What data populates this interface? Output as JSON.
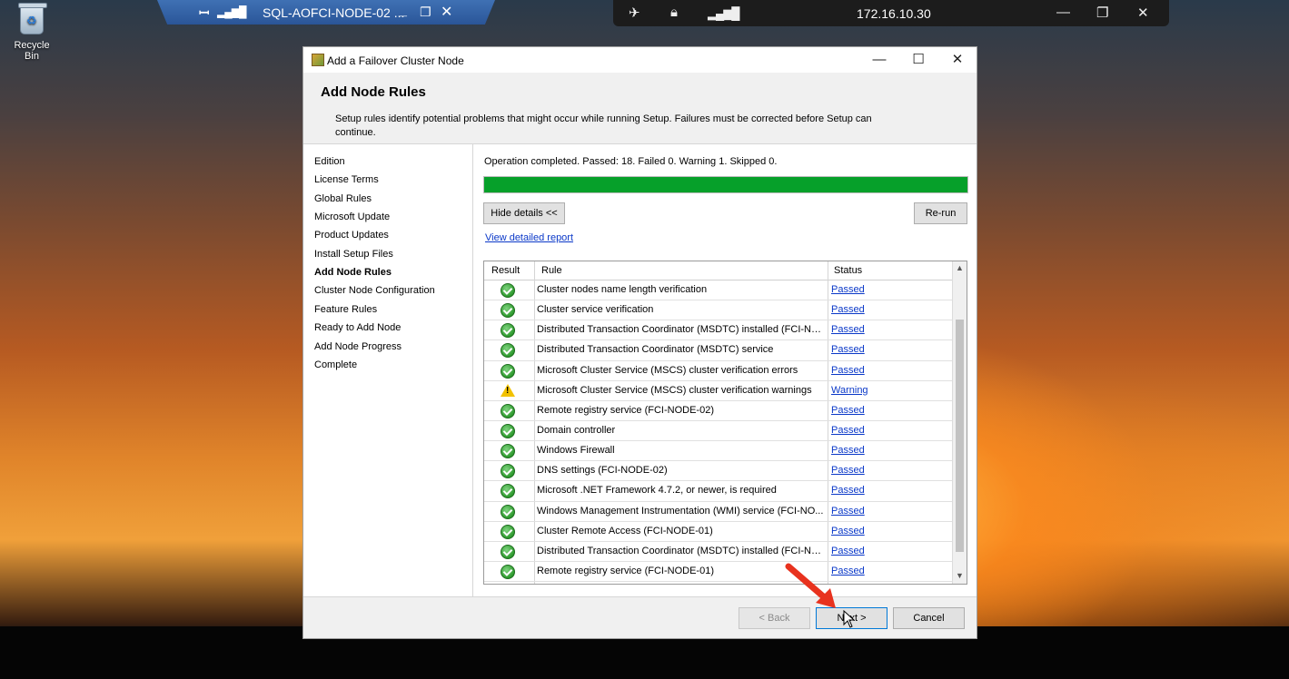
{
  "desktop": {
    "recycle_bin_label": "Recycle Bin"
  },
  "rdp_bar": {
    "title": "SQL-AOFCI-NODE-02 ..."
  },
  "remote_toolbar": {
    "ip_address": "172.16.10.30"
  },
  "dialog": {
    "window_title": "Add a Failover Cluster Node",
    "page_title": "Add Node Rules",
    "description": "Setup rules identify potential problems that might occur while running Setup. Failures must be corrected before Setup can continue.",
    "nav_items": [
      "Edition",
      "License Terms",
      "Global Rules",
      "Microsoft Update",
      "Product Updates",
      "Install Setup Files",
      "Add Node Rules",
      "Cluster Node Configuration",
      "Feature Rules",
      "Ready to Add Node",
      "Add Node Progress",
      "Complete"
    ],
    "active_nav": "Add Node Rules",
    "summary": "Operation completed. Passed: 18.   Failed 0.   Warning 1.   Skipped 0.",
    "progress_fraction": 1.0,
    "progress_color": "#06a02a",
    "hide_details_label": "Hide details <<",
    "rerun_label": "Re-run",
    "report_link": "View detailed report",
    "grid": {
      "columns": [
        "Result",
        "Rule",
        "Status"
      ],
      "rows": [
        {
          "result": "passed",
          "rule": "Cluster nodes name length verification",
          "status": "Passed"
        },
        {
          "result": "passed",
          "rule": "Cluster service verification",
          "status": "Passed"
        },
        {
          "result": "passed",
          "rule": "Distributed Transaction Coordinator (MSDTC) installed (FCI-NO...",
          "status": "Passed"
        },
        {
          "result": "passed",
          "rule": "Distributed Transaction Coordinator (MSDTC) service",
          "status": "Passed"
        },
        {
          "result": "passed",
          "rule": "Microsoft Cluster Service (MSCS) cluster verification errors",
          "status": "Passed"
        },
        {
          "result": "warning",
          "rule": "Microsoft Cluster Service (MSCS) cluster verification warnings",
          "status": "Warning"
        },
        {
          "result": "passed",
          "rule": "Remote registry service (FCI-NODE-02)",
          "status": "Passed"
        },
        {
          "result": "passed",
          "rule": "Domain controller",
          "status": "Passed"
        },
        {
          "result": "passed",
          "rule": "Windows Firewall",
          "status": "Passed"
        },
        {
          "result": "passed",
          "rule": "DNS settings (FCI-NODE-02)",
          "status": "Passed"
        },
        {
          "result": "passed",
          "rule": "Microsoft .NET Framework 4.7.2, or newer, is required",
          "status": "Passed"
        },
        {
          "result": "passed",
          "rule": "Windows Management Instrumentation (WMI) service (FCI-NO...",
          "status": "Passed"
        },
        {
          "result": "passed",
          "rule": "Cluster Remote Access (FCI-NODE-01)",
          "status": "Passed"
        },
        {
          "result": "passed",
          "rule": "Distributed Transaction Coordinator (MSDTC) installed (FCI-NO...",
          "status": "Passed"
        },
        {
          "result": "passed",
          "rule": "Remote registry service (FCI-NODE-01)",
          "status": "Passed"
        }
      ]
    },
    "buttons": {
      "back": "< Back",
      "next": "Next >",
      "cancel": "Cancel"
    }
  },
  "icons": {
    "pin": "pin-icon",
    "signal": "signal-icon",
    "minimize": "minimize-icon",
    "restore": "restore-icon",
    "close": "close-icon",
    "unpin": "unpin-icon",
    "lock": "lock-icon",
    "passed": "check-circle-icon",
    "warning": "warning-triangle-icon",
    "annotation_arrow": "red-arrow-icon"
  }
}
